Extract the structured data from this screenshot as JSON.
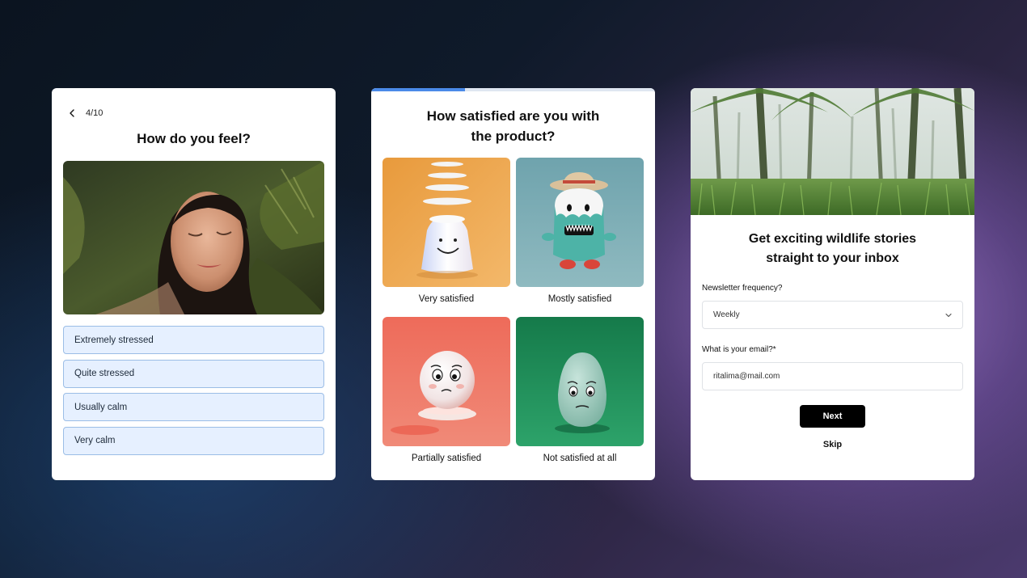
{
  "card1": {
    "step": "4/10",
    "title": "How do you feel?",
    "options": [
      "Extremely stressed",
      "Quite stressed",
      "Usually calm",
      "Very calm"
    ]
  },
  "card2": {
    "title_line1": "How satisfied are you with",
    "title_line2": "the product?",
    "progress": 0.33,
    "tiles": [
      {
        "label": "Very satisfied"
      },
      {
        "label": "Mostly satisfied"
      },
      {
        "label": "Partially satisfied"
      },
      {
        "label": "Not satisfied at all"
      }
    ]
  },
  "card3": {
    "title_line1": "Get exciting wildlife stories",
    "title_line2": "straight to your inbox",
    "frequency_label": "Newsletter frequency?",
    "frequency_value": "Weekly",
    "email_label": "What is your email?*",
    "email_value": "ritalima@mail.com",
    "next_label": "Next",
    "skip_label": "Skip"
  },
  "icons": {
    "back": "chevron-left-icon",
    "dropdown": "chevron-down-icon"
  },
  "colors": {
    "option_bg": "#e6f0ff",
    "option_border": "#9bbde6",
    "progress": "#4a8ae8",
    "button": "#000000"
  }
}
